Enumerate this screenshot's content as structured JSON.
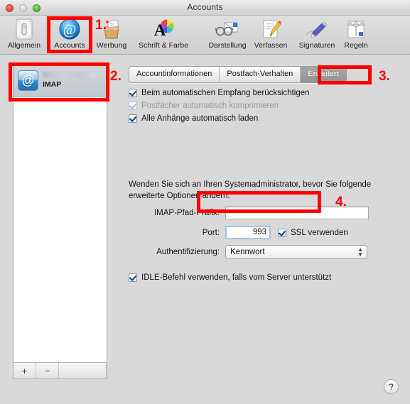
{
  "window": {
    "title": "Accounts",
    "traffic_lights": [
      "close",
      "minimize",
      "zoom"
    ]
  },
  "toolbar": {
    "items": [
      {
        "label": "Allgemein",
        "icon": "general-switch-icon",
        "selected": false
      },
      {
        "label": "Accounts",
        "icon": "at-sign-icon",
        "selected": true
      },
      {
        "label": "Werbung",
        "icon": "junk-mail-bag-icon",
        "selected": false
      },
      {
        "label": "Schrift & Farbe",
        "icon": "font-color-icon",
        "selected": false
      },
      {
        "label": "Darstellung",
        "icon": "viewing-glasses-icon",
        "selected": false
      },
      {
        "label": "Verfassen",
        "icon": "compose-pencil-icon",
        "selected": false
      },
      {
        "label": "Signaturen",
        "icon": "signature-pen-icon",
        "selected": false
      },
      {
        "label": "Regeln",
        "icon": "rules-arrows-icon",
        "selected": false
      }
    ]
  },
  "sidebar": {
    "accounts": [
      {
        "name": "IMAP",
        "icon": "at-sign-account-icon",
        "selected": true,
        "detail_redacted": true
      }
    ],
    "add_label": "+",
    "remove_label": "−"
  },
  "tabs": [
    {
      "label": "Accountinformationen",
      "selected": false
    },
    {
      "label": "Postfach-Verhalten",
      "selected": false
    },
    {
      "label": "Erweitert",
      "selected": true
    }
  ],
  "advanced": {
    "checkboxes": [
      {
        "label": "Beim automatischen Empfang berücksichtigen",
        "checked": true,
        "enabled": true
      },
      {
        "label": "Postfächer automatisch komprimieren",
        "checked": true,
        "enabled": false
      },
      {
        "label": "Alle Anhänge automatisch laden",
        "checked": true,
        "enabled": true
      }
    ],
    "note": "Wenden Sie sich an Ihren Systemadministrator, bevor Sie folgende erweiterte Optionen ändern:",
    "path_prefix": {
      "label": "IMAP-Pfad-Präfix:",
      "value": "",
      "placeholder": ""
    },
    "port": {
      "label": "Port:",
      "value": "993"
    },
    "ssl": {
      "label": "SSL verwenden",
      "checked": true
    },
    "authentication": {
      "label": "Authentifizierung:",
      "value": "Kennwort"
    },
    "idle": {
      "label": "IDLE-Befehl verwenden, falls vom Server unterstützt",
      "checked": true
    }
  },
  "annotations": [
    {
      "number": "1."
    },
    {
      "number": "2."
    },
    {
      "number": "3."
    },
    {
      "number": "4."
    }
  ],
  "help": {
    "label": "?"
  },
  "colors": {
    "annotation": "#ff0000",
    "selected_tab_bg": "#9a9a9a",
    "checkbox_accent": "#14427d"
  }
}
